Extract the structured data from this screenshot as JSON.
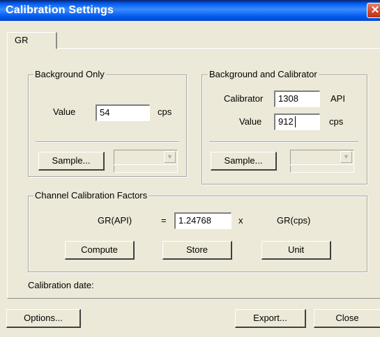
{
  "window": {
    "title": "Calibration Settings",
    "close_glyph": "✕"
  },
  "tabs": [
    {
      "label": "GR"
    }
  ],
  "background_only": {
    "legend": "Background Only",
    "value_label": "Value",
    "value": "54",
    "unit": "cps",
    "sample_label": "Sample..."
  },
  "background_calibrator": {
    "legend": "Background and Calibrator",
    "calibrator_label": "Calibrator",
    "calibrator_value": "1308",
    "calibrator_unit": "API",
    "value_label": "Value",
    "value": "912",
    "unit": "cps",
    "sample_label": "Sample..."
  },
  "channel_factors": {
    "legend": "Channel Calibration Factors",
    "lhs": "GR(API)",
    "equals": "=",
    "factor": "1.24768",
    "times": "x",
    "rhs": "GR(cps)",
    "compute_label": "Compute",
    "store_label": "Store",
    "unit_label": "Unit"
  },
  "calibration_date_label": "Calibration date:",
  "footer": {
    "options_label": "Options...",
    "export_label": "Export...",
    "close_label": "Close"
  },
  "icons": {
    "combo_arrow": "chevron-down-icon",
    "close": "close-icon"
  }
}
